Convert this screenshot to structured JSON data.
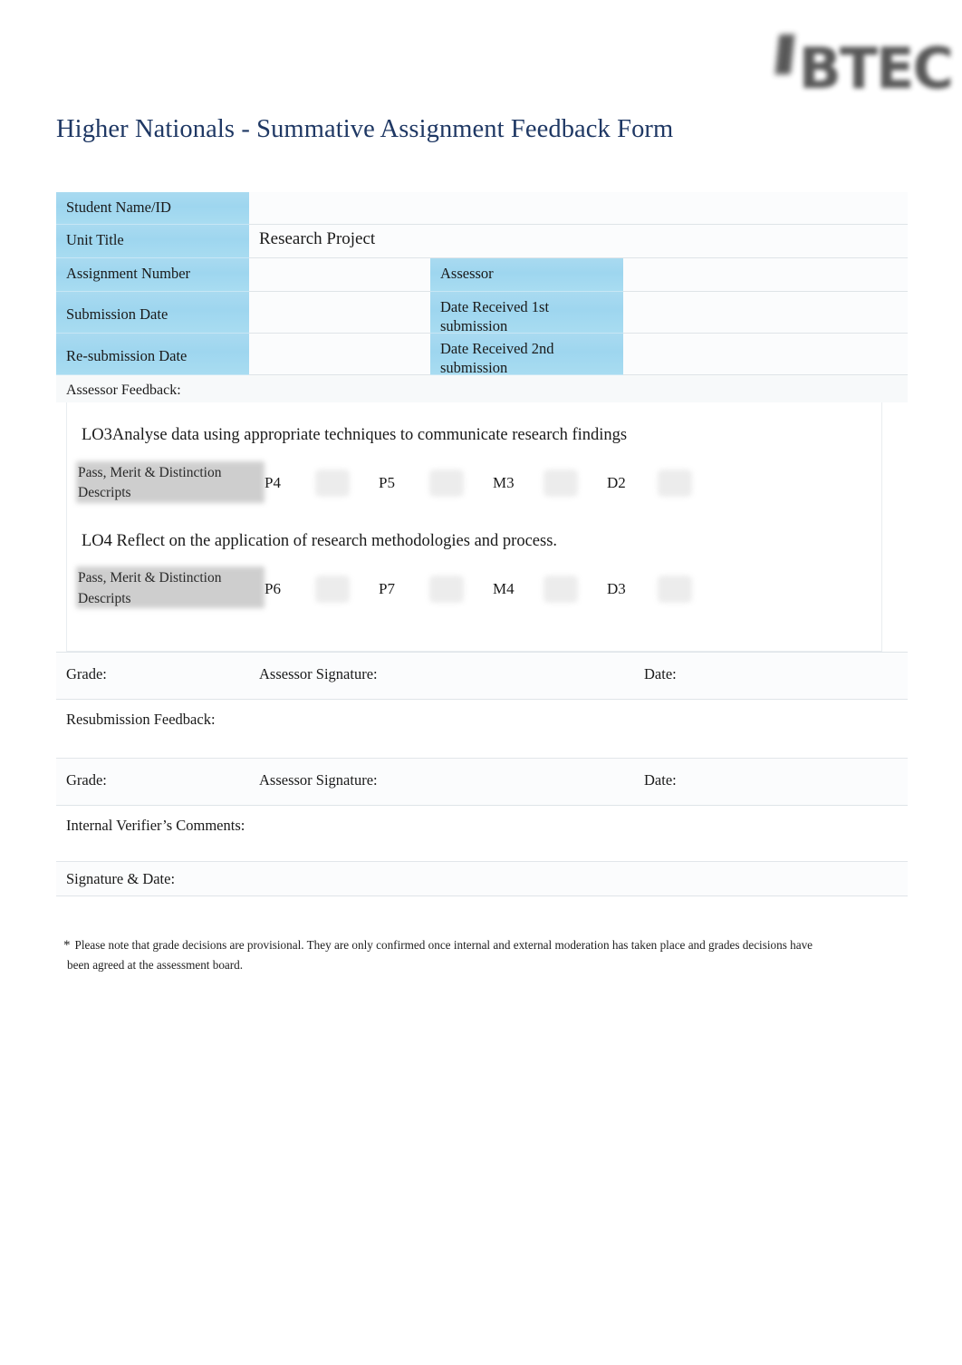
{
  "logo": {
    "text": "BTEC",
    "icon": "btec-logo"
  },
  "title": "Higher Nationals - Summative Assignment Feedback Form",
  "theme": {
    "title_color": "#1F3864",
    "header_blue": "#9ED6EF",
    "highlight_gray": "#a7a7a7"
  },
  "info_table": {
    "rows": [
      {
        "label": "Student Name/ID",
        "value": "",
        "label2": "",
        "value2": ""
      },
      {
        "label": "Unit Title",
        "value": "Research Project",
        "label2": "",
        "value2": ""
      },
      {
        "label": "Assignment  Number",
        "value": "",
        "label2": "Assessor",
        "value2": ""
      },
      {
        "label": "Submission Date",
        "value": "",
        "label2": "Date  Received  1st submission",
        "value2": ""
      },
      {
        "label": "Re-submission Date",
        "value": "",
        "label2": "Date  Received  2nd submission",
        "value2": ""
      }
    ]
  },
  "assessor_feedback": {
    "label": "Assessor  Feedback:",
    "learning_outcomes": [
      {
        "title": "LO3Analyse data using appropriate techniques to communicate research findings",
        "descriptor_label": "Pass, Merit & Distinction Descripts",
        "criteria": [
          "P4",
          "P5",
          "M3",
          "D2"
        ]
      },
      {
        "title": "LO4 Reflect on the application of research methodologies and process.",
        "descriptor_label": "Pass, Merit & Distinction Descripts",
        "criteria": [
          "P6",
          "P7",
          "M4",
          "D3"
        ]
      }
    ]
  },
  "grade_row_1": {
    "grade": "Grade:",
    "signature": "Assessor Signature:",
    "date": "Date:"
  },
  "resubmission": {
    "label": "Resubmission Feedback:"
  },
  "grade_row_2": {
    "grade": "Grade:",
    "signature": "Assessor Signature:",
    "date": "Date:"
  },
  "internal_verifier": {
    "comments_label": "Internal Verifier’s Comments:",
    "signature_label": "Signature & Date:"
  },
  "footnote": {
    "star": "*",
    "line1": "Please note that grade decisions are provisional. They are only confirmed once internal and external moderation has taken place and grades decisions have",
    "line2": "been agreed at the assessment board."
  }
}
